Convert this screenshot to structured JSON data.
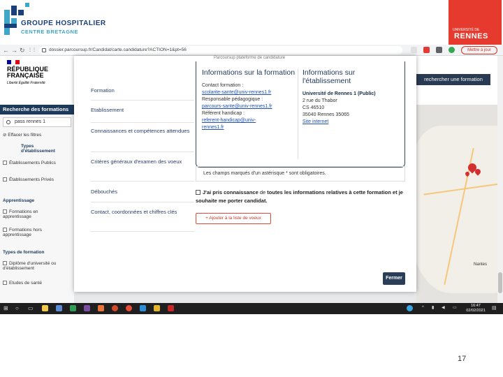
{
  "slide": {
    "logo_left": {
      "line1": "GROUPE HOSPITALIER",
      "line2": "CENTRE BRETAGNE"
    },
    "logo_right": {
      "line1": "UNIVERSITÉ DE",
      "line2": "RENNES"
    },
    "page_number": "17"
  },
  "browser": {
    "url": "dossier.parcoursup.fr/Candidat/carte.candidature?ACTION=1&pt=56",
    "pause_label": "Mettre à jour",
    "nav": {
      "back": "←",
      "forward": "→",
      "reload": "↻",
      "apps": "⋮⋮"
    }
  },
  "site": {
    "republic": {
      "line1": "RÉPUBLIQUE",
      "line2": "FRANÇAISE",
      "motto": "Liberté Égalité Fraternité"
    },
    "search_button": "rechercher une formation",
    "sidebar": {
      "title": "Recherche des formations",
      "search_value": "pass rennes 1",
      "clear_filters": "Effacer les filtres",
      "types_etab_head": "Types d'établissement",
      "etab_publics": "Établissements Publics",
      "etab_privees": "Établissements Privés",
      "apprentissage_head": "Apprentissage",
      "formation_apprentissage": "Formations en apprentissage",
      "formation_hors_apprentissage": "Formations hors apprentissage",
      "types_formation_head": "Types de formation",
      "diplome_univ": "Diplôme d'université ou d'établissement",
      "etudes_sante": "Etudes de santé"
    },
    "map": {
      "city": "Nantes"
    }
  },
  "modal": {
    "top_note": "Parcoursup plateforme de candidature",
    "left_menu": [
      "Formation",
      "Etablissement",
      "Connaissances et compétences attendues",
      "Critères généraux d'examen des voeux",
      "Débouchés",
      "Contact, coordonnées et chiffres clés"
    ],
    "info_formation": {
      "title": "Informations sur la formation",
      "contact_label": "Contact formation :",
      "contact_email": "scolarite-sante@univ-rennes1.fr",
      "resp_label": "Responsable pédagogique :",
      "resp_email": "parcours-sante@univ-rennes1.fr",
      "handicap_label": "Référent handicap :",
      "handicap_email_1": "referent-handicap@univ-",
      "handicap_email_2": "rennes1.fr"
    },
    "info_etablissement": {
      "title": "Informations sur l'établissement",
      "name": "Université de Rennes 1  (Public)",
      "addr1": "2 rue du Thabor",
      "addr2": "CS 46510",
      "addr3": "35040 Rennes 35065",
      "site_link": "Site internet"
    },
    "required_note": "Les champs marqués d'un astérisque * sont obligatoires.",
    "consent_prefix": "J'ai pris connaissance",
    "consent_de": "de",
    "consent_toutes": "toutes",
    "consent_middle": "les informations relatives à cette formation et",
    "consent_je": "je",
    "consent_end": "souhaite me porter candidat.",
    "add_button": "+ Ajouter à la liste de voeux",
    "close_button": "Fermer"
  },
  "taskbar": {
    "time": "16:47",
    "date": "02/02/2021"
  }
}
